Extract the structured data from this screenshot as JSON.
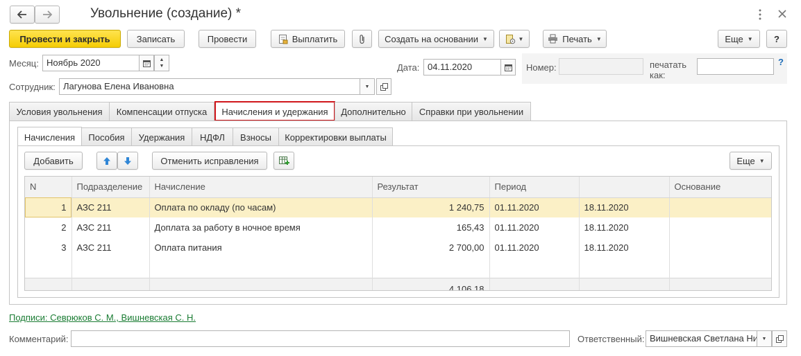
{
  "window": {
    "title": "Увольнение (создание) *",
    "menu_icon": "more-vertical-icon",
    "close_icon": "close-icon"
  },
  "toolbar": {
    "post_close": "Провести и закрыть",
    "save": "Записать",
    "post": "Провести",
    "pay": "Выплатить",
    "create_based": "Создать на основании",
    "print": "Печать",
    "more": "Еще",
    "help": "?"
  },
  "header": {
    "month_label": "Месяц:",
    "month_value": "Ноябрь 2020",
    "date_label": "Дата:",
    "date_value": "04.11.2020",
    "number_label": "Номер:",
    "number_value": "",
    "print_as_label_1": "печатать",
    "print_as_label_2": "как:",
    "print_as_value": "",
    "help_mark": "?",
    "employee_label": "Сотрудник:",
    "employee_value": "Лагунова Елена Ивановна"
  },
  "tabs": [
    {
      "label": "Условия увольнения"
    },
    {
      "label": "Компенсации отпуска"
    },
    {
      "label": "Начисления и удержания"
    },
    {
      "label": "Дополнительно"
    },
    {
      "label": "Справки при увольнении"
    }
  ],
  "subtabs": [
    {
      "label": "Начисления"
    },
    {
      "label": "Пособия"
    },
    {
      "label": "Удержания"
    },
    {
      "label": "НДФЛ"
    },
    {
      "label": "Взносы"
    },
    {
      "label": "Корректировки выплаты"
    }
  ],
  "inner_toolbar": {
    "add": "Добавить",
    "cancel_fix": "Отменить исправления",
    "more": "Еще"
  },
  "table": {
    "columns": [
      "N",
      "Подразделение",
      "Начисление",
      "Результат",
      "Период",
      "",
      "Основание"
    ],
    "rows": [
      {
        "n": "1",
        "dept": "АЗС 211",
        "accrual": "Оплата по окладу (по часам)",
        "result": "1 240,75",
        "from": "01.11.2020",
        "to": "18.11.2020",
        "basis": ""
      },
      {
        "n": "2",
        "dept": "АЗС 211",
        "accrual": "Доплата за работу в ночное время",
        "result": "165,43",
        "from": "01.11.2020",
        "to": "18.11.2020",
        "basis": ""
      },
      {
        "n": "3",
        "dept": "АЗС 211",
        "accrual": "Оплата питания",
        "result": "2 700,00",
        "from": "01.11.2020",
        "to": "18.11.2020",
        "basis": ""
      }
    ],
    "total": "4 106,18"
  },
  "footer": {
    "signatures_link": "Подписи: Севрюков С. М., Вишневская С. Н.",
    "comment_label": "Комментарий:",
    "comment_value": "",
    "responsible_label": "Ответственный:",
    "responsible_value": "Вишневская Светлана Ни"
  },
  "colors": {
    "primary_button": "#f5cd05",
    "active_tab_outline": "#d0161b",
    "selected_row": "#fbf0c6",
    "link": "#1a7c33"
  }
}
